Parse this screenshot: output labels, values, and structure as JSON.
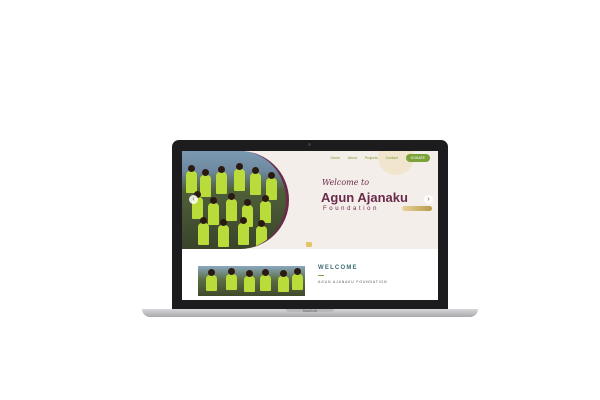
{
  "nav": {
    "links": [
      "Home",
      "About",
      "Projects",
      "Contact"
    ],
    "donate_label": "DONATE"
  },
  "hero": {
    "script_text": "Welcome to",
    "title": "Agun Ajanaku",
    "subtitle": "Foundation"
  },
  "welcome": {
    "heading": "WELCOME",
    "subheading": "AGUN AJANAKU FOUNDATION"
  },
  "device": {
    "model_label": "MacBook"
  },
  "colors": {
    "brand_plum": "#6b2a4a",
    "accent_green": "#7ba33a",
    "teal_heading": "#3c6b73",
    "gold": "#e3c567"
  }
}
